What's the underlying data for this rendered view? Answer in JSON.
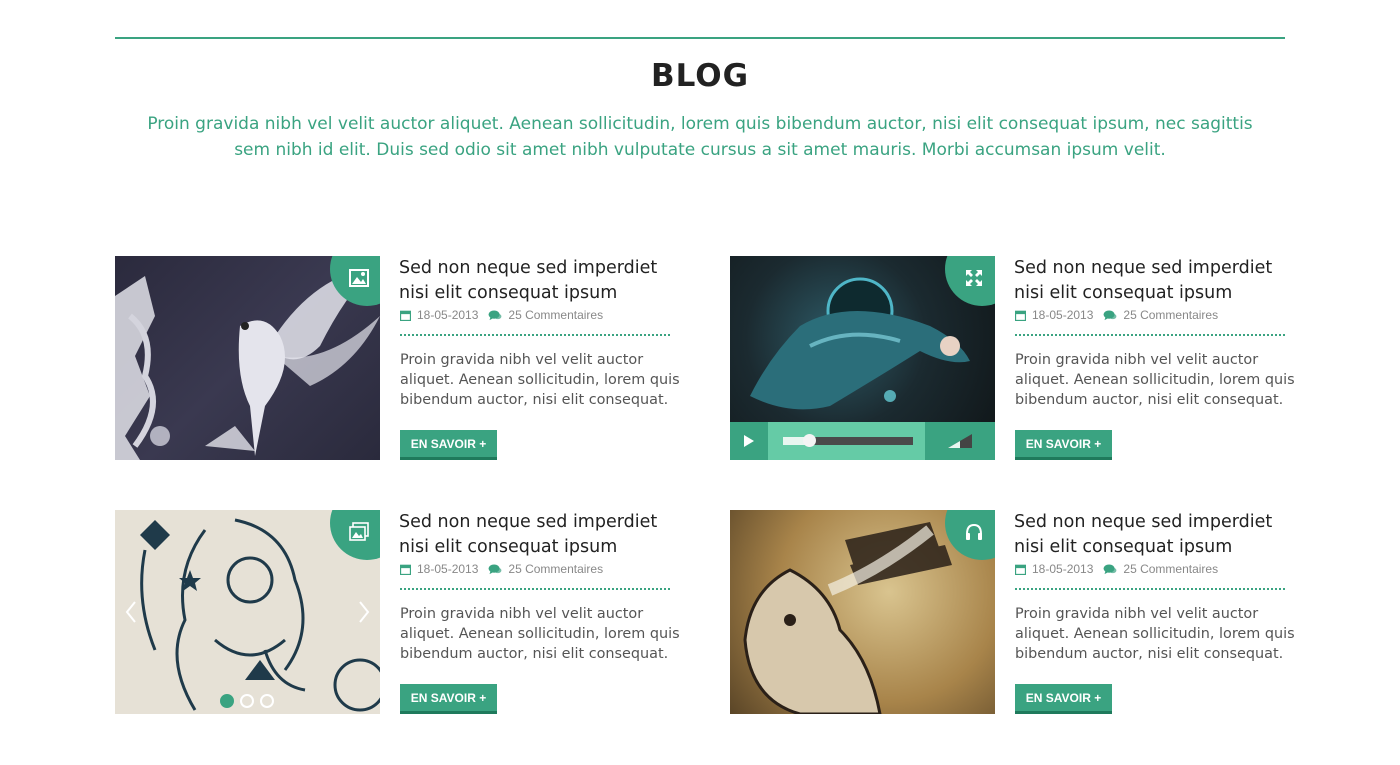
{
  "section": {
    "title": "BLOG",
    "intro": "Proin gravida nibh vel velit auctor aliquet. Aenean sollicitudin, lorem quis bibendum auctor, nisi elit consequat ipsum, nec sagittis sem nibh id elit. Duis sed odio sit amet nibh vulputate cursus a sit amet mauris. Morbi accumsan ipsum velit."
  },
  "colors": {
    "accent": "#3aa381",
    "accent_light": "#65cba6",
    "dark": "#222222"
  },
  "posts": [
    {
      "title": "Sed non neque sed imperdiet nisi elit consequat ipsum",
      "date": "18-05-2013",
      "comments": "25 Commentaires",
      "excerpt": "Proin gravida nibh vel velit auctor aliquet. Aenean sollicitudin, lorem quis bibendum auctor, nisi elit consequat.",
      "button": "EN SAVOIR +",
      "media": "image",
      "corner_icon": "image-icon"
    },
    {
      "title": "Sed non neque sed imperdiet nisi elit consequat ipsum",
      "date": "18-05-2013",
      "comments": "25 Commentaires",
      "excerpt": "Proin gravida nibh vel velit auctor aliquet. Aenean sollicitudin, lorem quis bibendum auctor, nisi elit consequat.",
      "button": "EN SAVOIR +",
      "media": "video",
      "corner_icon": "expand-icon",
      "player": {
        "progress": 0.2
      }
    },
    {
      "title": "Sed non neque sed imperdiet nisi elit consequat ipsum",
      "date": "18-05-2013",
      "comments": "25 Commentaires",
      "excerpt": "Proin gravida nibh vel velit auctor aliquet. Aenean sollicitudin, lorem quis bibendum auctor, nisi elit consequat.",
      "button": "EN SAVOIR +",
      "media": "gallery",
      "corner_icon": "gallery-icon",
      "slides": 3,
      "active_slide": 1
    },
    {
      "title": "Sed non neque sed imperdiet nisi elit consequat ipsum",
      "date": "18-05-2013",
      "comments": "25 Commentaires",
      "excerpt": "Proin gravida nibh vel velit auctor aliquet. Aenean sollicitudin, lorem quis bibendum auctor, nisi elit consequat.",
      "button": "EN SAVOIR +",
      "media": "audio",
      "corner_icon": "headphones-icon"
    }
  ]
}
